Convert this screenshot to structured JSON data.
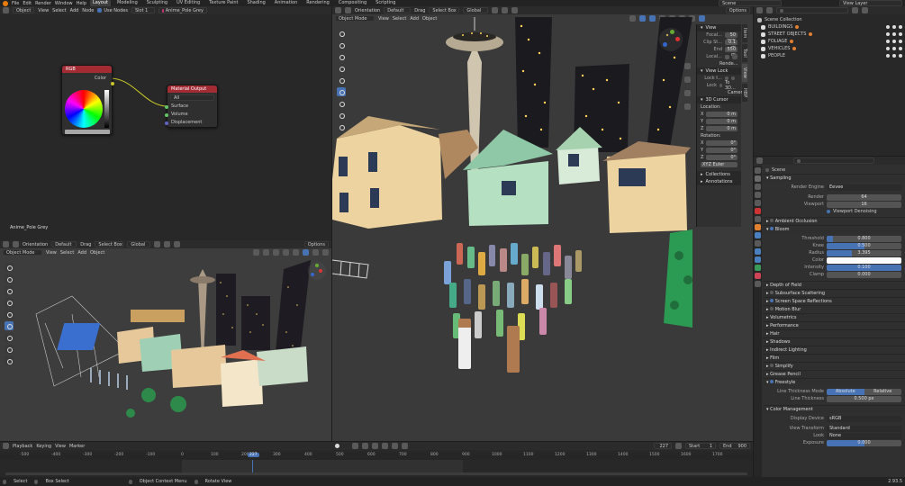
{
  "topbar": {
    "menus": [
      "File",
      "Edit",
      "Render",
      "Window",
      "Help"
    ],
    "workspaces": [
      "Layout",
      "Modeling",
      "Sculpting",
      "UV Editing",
      "Texture Paint",
      "Shading",
      "Animation",
      "Rendering",
      "Compositing",
      "Scripting"
    ],
    "active_workspace": "Layout",
    "scene": "Scene",
    "view_layer": "View Layer"
  },
  "node_editor": {
    "mode": "Object",
    "menus": [
      "View",
      "Select",
      "Add",
      "Node"
    ],
    "use_nodes": "Use Nodes",
    "slot": "Slot 1",
    "material": "Anime_Pole Grey",
    "footer_label": "Anime_Pole Grey",
    "rgb_node": {
      "title": "RGB",
      "output": "Color"
    },
    "output_node": {
      "title": "Material Output",
      "target": "All",
      "inputs": [
        "Surface",
        "Volume",
        "Displacement"
      ]
    }
  },
  "viewport_small": {
    "orientation": "Orientation",
    "orientation_val": "Default",
    "drag": "Drag",
    "drag_val": "Select Box",
    "transform": "Global",
    "mode": "Object Mode",
    "menus": [
      "View",
      "Select",
      "Add",
      "Object"
    ],
    "options": "Options"
  },
  "viewport_main": {
    "orientation": "Orientation",
    "orientation_val": "Default",
    "drag": "Drag",
    "drag_val": "Select Box",
    "transform": "Global",
    "mode": "Object Mode",
    "menus": [
      "View",
      "Select",
      "Add",
      "Object"
    ],
    "options": "Options"
  },
  "n_panel": {
    "tabs": [
      "Item",
      "Tool",
      "View",
      "HBP"
    ],
    "view_header": "View",
    "focal_label": "Focal...",
    "focal": "50 mm",
    "clip_start_label": "Clip St...",
    "clip_start": "0.1 m",
    "clip_end_label": "End",
    "clip_end": "550 m",
    "local_label": "Local...",
    "render_label": "Rende...",
    "view_lock": "View Lock",
    "lock_label": "Lock t...",
    "lock2_label": "Lock",
    "to3d": "To 3D...",
    "camera": "Camer...",
    "cursor_header": "3D Cursor",
    "location": "Location:",
    "loc": [
      {
        "a": "X",
        "v": "0 m"
      },
      {
        "a": "Y",
        "v": "0 m"
      },
      {
        "a": "Z",
        "v": "0 m"
      }
    ],
    "rotation": "Rotation:",
    "rot": [
      {
        "a": "X",
        "v": "0°"
      },
      {
        "a": "Y",
        "v": "0°"
      },
      {
        "a": "Z",
        "v": "0°"
      }
    ],
    "rot_mode": "XYZ Euler",
    "collections": "Collections",
    "annotations": "Annotations"
  },
  "outliner": {
    "root": "Scene Collection",
    "items": [
      "BUILDINGS",
      "STREET OBJECTS",
      "FOLIAGE",
      "VEHICLES",
      "PEOPLE"
    ]
  },
  "properties": {
    "scene": "Scene",
    "sampling": "Sampling",
    "render_engine_label": "Render Engine",
    "render_engine": "Eevee",
    "render_label": "Render",
    "render_samples": "64",
    "viewport_label": "Viewport",
    "viewport_samples": "16",
    "viewport_denoising": "Viewport Denoising",
    "ambient_occlusion": "Ambient Occlusion",
    "bloom": "Bloom",
    "threshold_label": "Threshold",
    "threshold": "0.800",
    "threshold_frac": 0.08,
    "knee_label": "Knee",
    "knee": "0.500",
    "knee_frac": 0.5,
    "radius_label": "Radius",
    "radius": "3.395",
    "radius_frac": 0.34,
    "color_label": "Color",
    "intensity_label": "Intensity",
    "intensity": "0.100",
    "intensity_frac": 1.0,
    "clamp_label": "Clamp",
    "clamp": "0.000",
    "sections": [
      "Depth of Field",
      "Subsurface Scattering",
      "Screen Space Reflections",
      "Motion Blur",
      "Volumetrics",
      "Performance",
      "Hair",
      "Shadows",
      "Indirect Lighting",
      "Film",
      "Simplify",
      "Grease Pencil",
      "Freestyle"
    ],
    "line_mode_label": "Line Thickness Mode",
    "absolute": "Absolute",
    "relative": "Relative",
    "line_thickness_label": "Line Thickness",
    "line_thickness": "0.500 px",
    "color_mgmt": "Color Management",
    "display_device_label": "Display Device",
    "display_device": "sRGB",
    "view_transform_label": "View Transform",
    "view_transform": "Standard",
    "look_label": "Look",
    "look": "None",
    "exposure_label": "Exposure",
    "exposure": "0.000"
  },
  "timeline": {
    "menus": [
      "Playback",
      "Keying",
      "View",
      "Marker"
    ],
    "current_frame": "227",
    "start_label": "Start",
    "start": "1",
    "end_label": "End",
    "end": "900",
    "ticks": [
      "-500",
      "-400",
      "-300",
      "-200",
      "-100",
      "0",
      "100",
      "200",
      "300",
      "400",
      "500",
      "600",
      "700",
      "800",
      "900",
      "1000",
      "1100",
      "1200",
      "1300",
      "1400",
      "1500",
      "1600",
      "1700"
    ],
    "playhead": "227"
  },
  "statusbar": {
    "select": "Select",
    "box_select": "Box Select",
    "context_menu": "Object Context Menu",
    "rotate_view": "Rotate View",
    "version": "2.93.5"
  },
  "colors": {
    "accent": "#4772b3",
    "rgb_header": "#a22b34",
    "output_header": "#a22b34"
  }
}
